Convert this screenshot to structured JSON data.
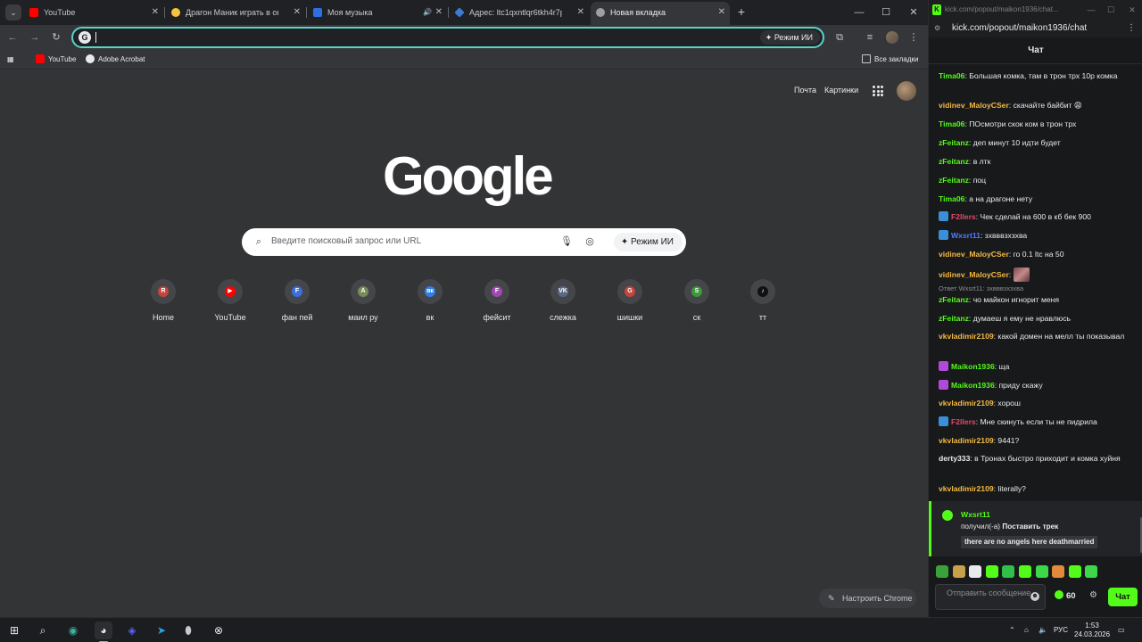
{
  "browser": {
    "tabs": [
      {
        "title": "YouTube",
        "fav_color": "#ff0000"
      },
      {
        "title": "Драгон Маник играть в онлайн",
        "fav_color": "#f4c542"
      },
      {
        "title": "Моя музыка",
        "fav_color": "#2f6fe4",
        "sound": "🔊"
      },
      {
        "title": "Адрес: ltc1qxntlqr6tkh4r7p6c3",
        "fav_color": "#3a7bd5"
      },
      {
        "title": "Новая вкладка",
        "fav_color": "#9aa0a6"
      }
    ],
    "omnibox": {
      "letter": "G",
      "value": "",
      "ai_mode": "Режим ИИ"
    },
    "bookmarks": [
      {
        "label": "YouTube",
        "color": "#ff0000"
      },
      {
        "label": "Adobe Acrobat",
        "color": "#e8eaed"
      }
    ],
    "all_bookmarks": "Все закладки"
  },
  "ntp": {
    "links": {
      "mail": "Почта",
      "images": "Картинки"
    },
    "logo": "Google",
    "search": {
      "placeholder": "Введите поисковый запрос или URL",
      "ai_mode": "Режим ИИ"
    },
    "shortcuts": [
      {
        "label": "Home",
        "letter": "R",
        "color": "#c5453c"
      },
      {
        "label": "YouTube",
        "letter": "▶",
        "color": "#ff0000"
      },
      {
        "label": "фан пей",
        "letter": "F",
        "color": "#3b6fe0"
      },
      {
        "label": "маил ру",
        "letter": "A",
        "color": "#7a8a55"
      },
      {
        "label": "вк",
        "letter": "вк",
        "color": "#2f7fe4"
      },
      {
        "label": "фейсит",
        "letter": "F",
        "color": "#a447b6"
      },
      {
        "label": "слежка",
        "letter": "VK",
        "color": "#5a6a85"
      },
      {
        "label": "шишки",
        "letter": "G",
        "color": "#c5453c"
      },
      {
        "label": "ск",
        "letter": "S",
        "color": "#3a9a3a"
      },
      {
        "label": "тт",
        "letter": "♪",
        "color": "#111111"
      }
    ],
    "customize": "Настроить Chrome"
  },
  "kick": {
    "window_title": "kick.com/popout/maikon1936/chat...",
    "url": "kick.com/popout/maikon1936/chat",
    "header": "Чат",
    "messages": [
      {
        "user": "Tima06",
        "color": "#53fc18",
        "text": "Большая комка, там в трон трх 10р комка"
      },
      {
        "user": "vidinev_MaloyCSer",
        "color": "#f4b942",
        "text": "скачайте байбит 😩"
      },
      {
        "user": "Tima06",
        "color": "#53fc18",
        "text": "ПОсмотри скок ком в трон трх"
      },
      {
        "user": "zFeitanz",
        "color": "#53fc18",
        "text": "деп минут 10 идти будет"
      },
      {
        "user": "zFeitanz",
        "color": "#53fc18",
        "text": "в лтк"
      },
      {
        "user": "zFeitanz",
        "color": "#53fc18",
        "text": "поц"
      },
      {
        "user": "Tima06",
        "color": "#53fc18",
        "text": "а на драгоне нету"
      },
      {
        "user": "F2llers",
        "color": "#e04a6a",
        "text": "Чек сделай на 600 в кб бек 900",
        "badge": "#3a8fd8"
      },
      {
        "user": "Wxsrt11",
        "color": "#4f7cff",
        "text": "зхвввзхзхва",
        "badge": "#3a8fd8"
      },
      {
        "user": "vidinev_MaloyCSer",
        "color": "#f4b942",
        "text": "го 0.1 ltc на 50"
      },
      {
        "user": "vidinev_MaloyCSer",
        "color": "#f4b942",
        "text": "",
        "emote": true
      },
      {
        "reply": "Ответ Wxsrt11: зхвввзхзхва"
      },
      {
        "user": "zFeitanz",
        "color": "#53fc18",
        "text": "чо майкон игнорит меня"
      },
      {
        "user": "zFeitanz",
        "color": "#53fc18",
        "text": "думаеш я ему не нравлюсь"
      },
      {
        "user": "vkvladimir2109",
        "color": "#f4b942",
        "text": "какой домен на мелл ты показывал"
      },
      {
        "user": "Maikon1936",
        "color": "#53fc18",
        "text": "ща",
        "badge": "#b04ad8"
      },
      {
        "user": "Maikon1936",
        "color": "#53fc18",
        "text": "приду скажу",
        "badge": "#b04ad8"
      },
      {
        "user": "vkvladimir2109",
        "color": "#f4b942",
        "text": "хорош"
      },
      {
        "user": "F2llers",
        "color": "#e04a6a",
        "text": "Мне скинуть если ты не пидрила",
        "badge": "#3a8fd8"
      },
      {
        "user": "vkvladimir2109",
        "color": "#f4b942",
        "text": "9441?"
      },
      {
        "user": "derty333",
        "color": "#e8eaed",
        "text": "в Тронах быстро приходит и комка хуйня"
      },
      {
        "user": "vkvladimir2109",
        "color": "#f4b942",
        "text": "literally?"
      }
    ],
    "reward": {
      "user": "Wxsrt11",
      "action_prefix": "получил(-а) ",
      "action": "Поставить трек",
      "track": "there are no angels here deathmarried"
    },
    "emote_colors": [
      "#3aa23a",
      "#c8a04a",
      "#e8eaed",
      "#53fc18",
      "#2fbf4a",
      "#53fc18",
      "#3bd84a",
      "#e08a3a",
      "#53fc18",
      "#3bd84a"
    ],
    "input_placeholder": "Отправить сообщение",
    "points": "60",
    "send": "Чат"
  },
  "taskbar": {
    "lang": "РУС",
    "time": "1:53",
    "date": "24.03.2026"
  }
}
